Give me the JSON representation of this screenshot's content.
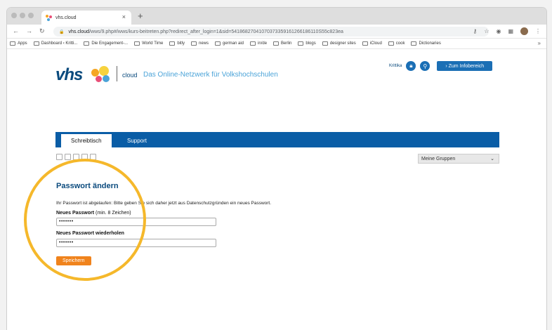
{
  "browser": {
    "tab_title": "vhs.cloud",
    "tab_close": "×",
    "new_tab": "+",
    "url_host": "vhs.cloud",
    "url_path": "/wws/9.php#/wws/kurs-beitreten.php?redirect_after_login=1&sid=54186827041070373359161266186110S55c823ea",
    "bookmarks": [
      "Apps",
      "Dashboard ‹ Kritti...",
      "Die Engagement-...",
      "World Time",
      "bitly",
      "news",
      "german aid",
      "in/de",
      "Berlin",
      "blogs",
      "designer sites",
      "iCloud",
      "cook",
      "Dictionaries"
    ],
    "bookmarks_more": "»"
  },
  "site": {
    "logo_text": "vhs",
    "cloud_label": "cloud",
    "tagline": "Das Online-Netzwerk für Volkshochschulen",
    "user_name": "Krittika",
    "info_button": "› Zum Infobereich"
  },
  "nav": {
    "tabs": [
      "Schreibtisch",
      "Support"
    ]
  },
  "groups_select": {
    "value": "Meine Gruppen"
  },
  "form": {
    "title": "Passwort ändern",
    "message": "Ihr Passwort ist abgelaufen: Bitte geben Sie sich daher jetzt aus Datenschutzgründen ein neues Passwort.",
    "new_label": "Neues Passwort",
    "new_hint": " (min. 8 Zeichen)",
    "new_value": "•••••••",
    "repeat_label": "Neues Passwort wiederholen",
    "repeat_value": "•••••••",
    "save_label": "Speichern"
  },
  "colors": {
    "brand_blue": "#0a5da6",
    "accent_orange": "#f0831c",
    "highlight_circle": "#f5b82b"
  }
}
